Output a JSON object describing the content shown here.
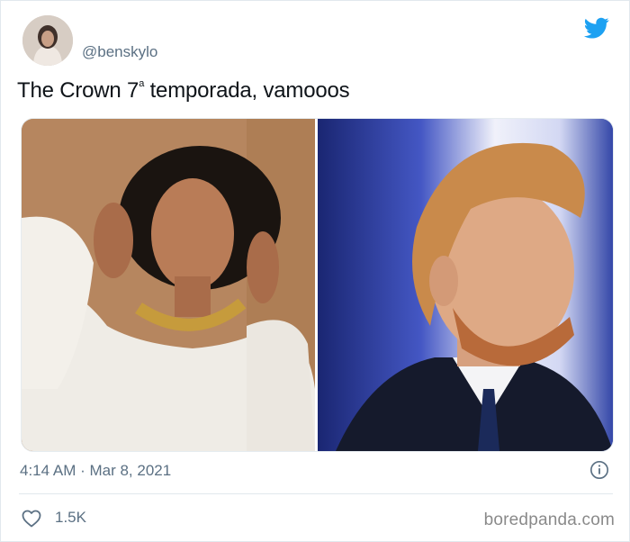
{
  "tweet": {
    "handle": "@benskylo",
    "text_main": "The Crown 7",
    "text_sup": "a",
    "text_tail": " temporada, vamooos",
    "time": "4:14 AM · Mar 8, 2021",
    "likes": "1.5K"
  },
  "icons": {
    "brand": "twitter-bird-icon",
    "info": "info-icon",
    "like": "heart-icon"
  },
  "colors": {
    "twitter_blue": "#1DA1F2",
    "meta_gray": "#5B7083",
    "text": "#0F1419"
  },
  "watermark": "boredpanda.com"
}
